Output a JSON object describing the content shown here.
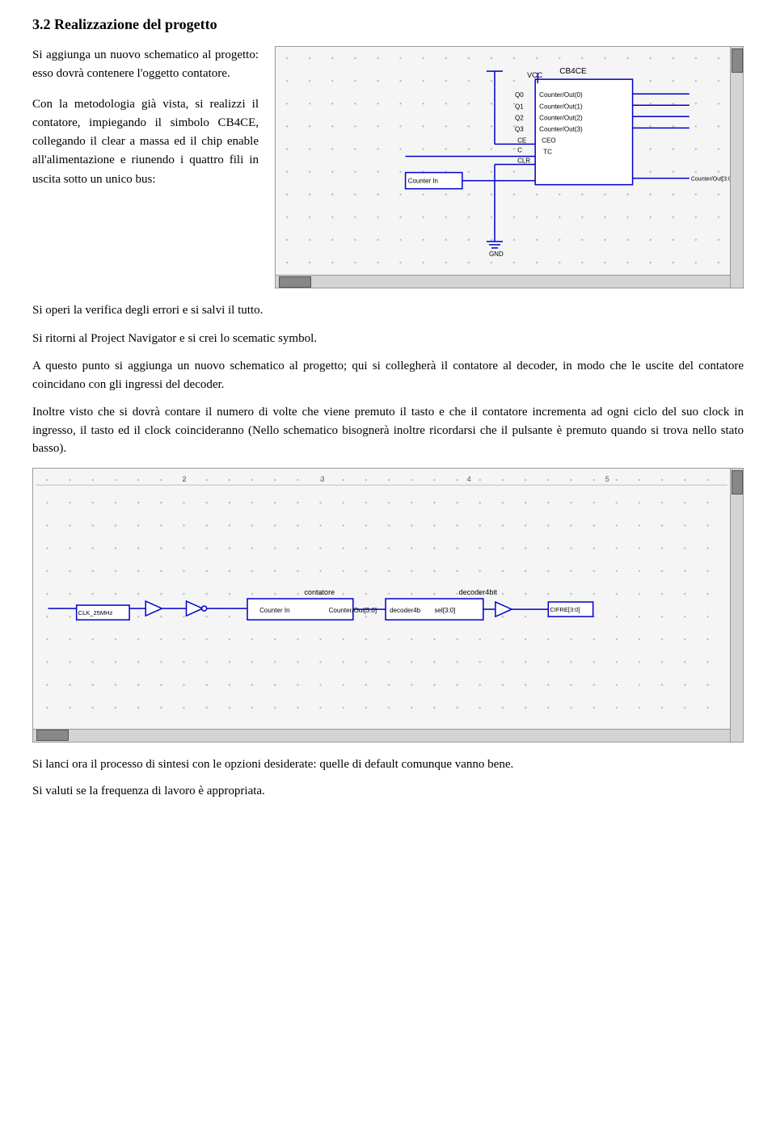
{
  "heading": "3.2  Realizzazione del progetto",
  "para1": "Si aggiunga un nuovo schematico al progetto: esso dovrà contenere l'oggetto contatore.",
  "para2": "Con la metodologia già vista, si realizzi il contatore, impiegando il simbolo CB4CE, collegando il clear a massa ed il chip enable all'alimentazione e riunendo i quattro fili in uscita sotto un unico bus:",
  "caption1": "Si operi la verifica degli errori e si salvi il tutto.",
  "caption2": "Si ritorni al Project Navigator e si crei lo scematic symbol.",
  "para3": "A questo punto si aggiunga un nuovo schematico al progetto; qui si collegherà il contatore al decoder, in modo che le uscite del contatore coincidano con gli ingressi del decoder.",
  "para4": "Inoltre visto che si dovrà contare il numero di volte che viene premuto il tasto e che il contatore incrementa ad ogni ciclo del suo clock in ingresso, il tasto ed il clock coincideranno (Nello schematico bisognerà inoltre ricordarsi che il pulsante è premuto quando si trova nello stato basso).",
  "caption3": "Si lanci ora il processo di sintesi con le opzioni desiderate: quelle di default comunque vanno bene.",
  "caption4": "Si valuti se la frequenza di lavoro è appropriata."
}
